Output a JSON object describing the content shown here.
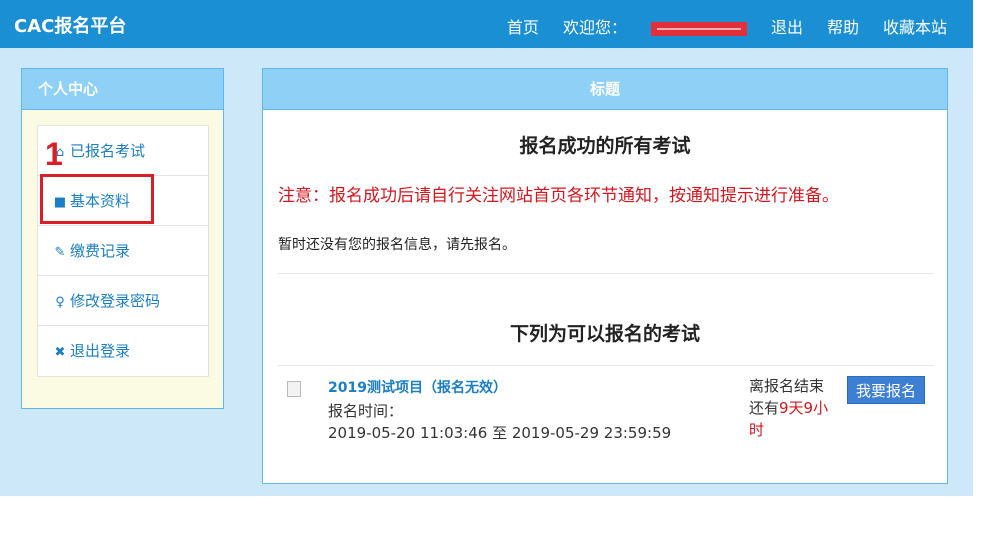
{
  "header": {
    "brand": "CAC报名平台",
    "nav": {
      "home": "首页",
      "welcome_prefix": "欢迎您：",
      "logout": "退出",
      "help": "帮助",
      "bookmark": "收藏本站"
    }
  },
  "sidebar": {
    "title": "个人中心",
    "items": [
      {
        "label": "已报名考试",
        "icon": "home-icon"
      },
      {
        "label": "基本资料",
        "icon": "book-icon"
      },
      {
        "label": "缴费记录",
        "icon": "pencil-icon"
      },
      {
        "label": "修改登录密码",
        "icon": "user-key-icon"
      },
      {
        "label": "退出登录",
        "icon": "close-icon"
      }
    ]
  },
  "annotation": {
    "step_number": "1"
  },
  "main": {
    "panel_title": "标题",
    "registered_title": "报名成功的所有考试",
    "notice": "注意：报名成功后请自行关注网站首页各环节通知，按通知提示进行准备。",
    "empty_message": "暂时还没有您的报名信息，请先报名。",
    "available_title": "下列为可以报名的考试",
    "exam": {
      "name": "2019测试项目（报名无效）",
      "time_label": "报名时间：",
      "time_range": "2019-05-20 11:03:46 至 2019-05-29 23:59:59",
      "countdown_prefix": "离报名结束还有",
      "countdown_value": "9天9小时",
      "apply_label": "我要报名"
    }
  },
  "colors": {
    "header_bg": "#1a8fd3",
    "panel_head": "#8ed0f6",
    "page_bg": "#cde9f9",
    "link": "#1a7fc4",
    "alert": "#d6161e",
    "annotation": "#d92027",
    "button": "#3d7fd3"
  }
}
